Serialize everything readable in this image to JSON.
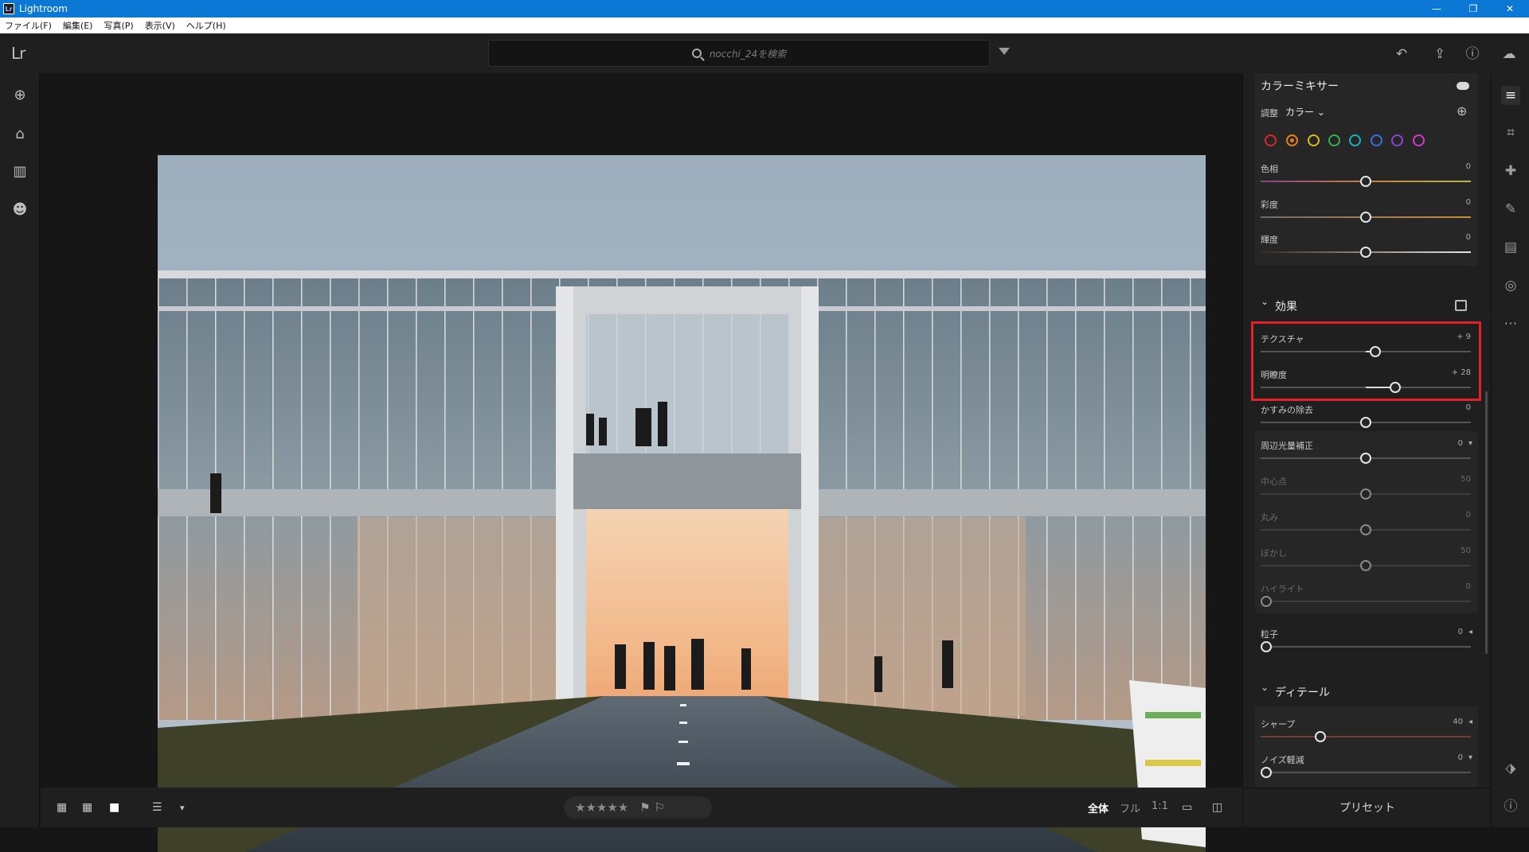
{
  "window": {
    "title": "Lightroom",
    "app_icon_text": "Lr",
    "minimize": "—",
    "maximize": "❐",
    "close": "✕"
  },
  "menu": [
    "ファイル(F)",
    "編集(E)",
    "写真(P)",
    "表示(V)",
    "ヘルプ(H)"
  ],
  "topbar": {
    "logo": "Lr",
    "search_placeholder": "nocchi_24を検索"
  },
  "right_panel": {
    "color_mixer": {
      "title": "カラーミキサー",
      "adjust_label": "調整",
      "adjust_value": "カラー",
      "swatches": [
        "#d62a2a",
        "#e87d1e",
        "#d6c21a",
        "#2fb34a",
        "#1bb1c0",
        "#3a6ee0",
        "#8a45d6",
        "#d23ad0"
      ],
      "selected_swatch": 1,
      "sliders": [
        {
          "label": "色相",
          "value": "0",
          "pos": 0.5
        },
        {
          "label": "彩度",
          "value": "0",
          "pos": 0.5
        },
        {
          "label": "輝度",
          "value": "0",
          "pos": 0.5
        }
      ]
    },
    "effects": {
      "title": "効果",
      "sliders": [
        {
          "label": "テクスチャ",
          "value": "+ 9",
          "pos": 0.545
        },
        {
          "label": "明瞭度",
          "value": "+ 28",
          "pos": 0.64
        },
        {
          "label": "かすみの除去",
          "value": "0",
          "pos": 0.5
        },
        {
          "label": "周辺光量補正",
          "value": "0",
          "pos": 0.5
        },
        {
          "label": "中心点",
          "value": "50",
          "pos": 0.5
        },
        {
          "label": "丸み",
          "value": "0",
          "pos": 0.5
        },
        {
          "label": "ぼかし",
          "value": "50",
          "pos": 0.5
        },
        {
          "label": "ハイライト",
          "value": "0",
          "pos": 0.0
        },
        {
          "label": "粒子",
          "value": "0",
          "pos": 0.0
        }
      ]
    },
    "detail": {
      "title": "ディテール",
      "sliders": [
        {
          "label": "シャープ",
          "value": "40",
          "pos": 0.28
        },
        {
          "label": "ノイズ軽減",
          "value": "0",
          "pos": 0.0
        }
      ]
    },
    "presets_label": "プリセット"
  },
  "bottombar": {
    "rating_stars": "★★★★★",
    "flags": "⚑ ⚐",
    "zoom_options": [
      "全体",
      "フル",
      "1:1"
    ]
  }
}
